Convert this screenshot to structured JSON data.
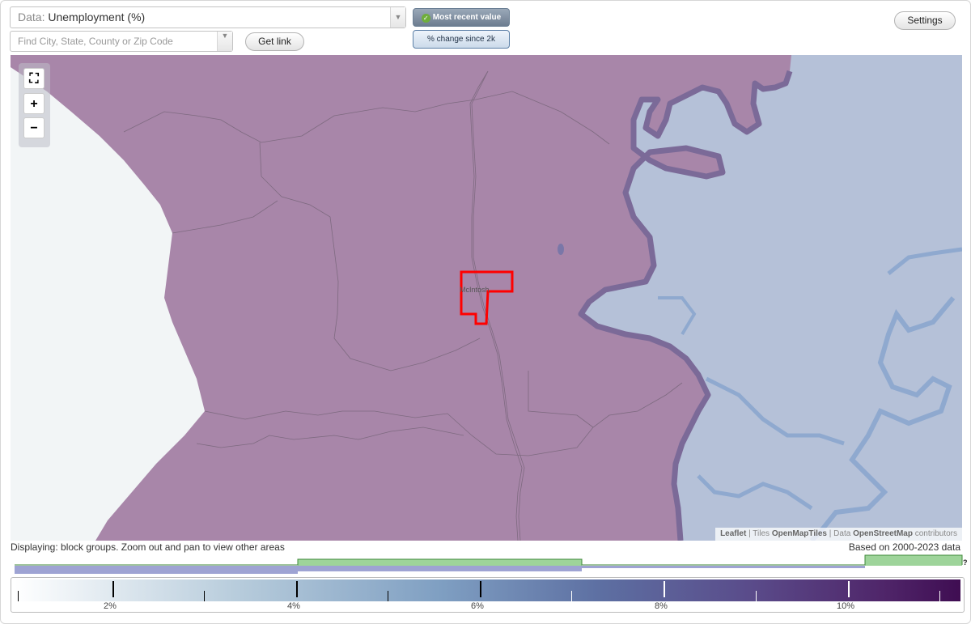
{
  "data_select": {
    "prefix": "Data:",
    "value": "Unemployment (%)"
  },
  "search": {
    "placeholder": "Find City, State, County or Zip Code"
  },
  "buttons": {
    "get_link": "Get link",
    "settings": "Settings"
  },
  "modes": {
    "active": "Most recent value",
    "inactive": "% change since 2k"
  },
  "map": {
    "place_label": "McIntosh",
    "attribution": {
      "leaflet": "Leaflet",
      "tiles_prefix": "Tiles",
      "tiles_source": "OpenMapTiles",
      "data_prefix": "Data",
      "data_source": "OpenStreetMap",
      "data_suffix": "contributors"
    },
    "colors": {
      "land": "#a886a9",
      "water": "#b5c1d8",
      "highlight": "#ff0000"
    }
  },
  "notes": {
    "display": "Displaying: block groups. Zoom out and pan to view other areas",
    "based_on": "Based on 2000-2023 data"
  },
  "legend": {
    "tick_labels": [
      "2%",
      "4%",
      "6%",
      "8%",
      "10%"
    ],
    "help": "?"
  }
}
